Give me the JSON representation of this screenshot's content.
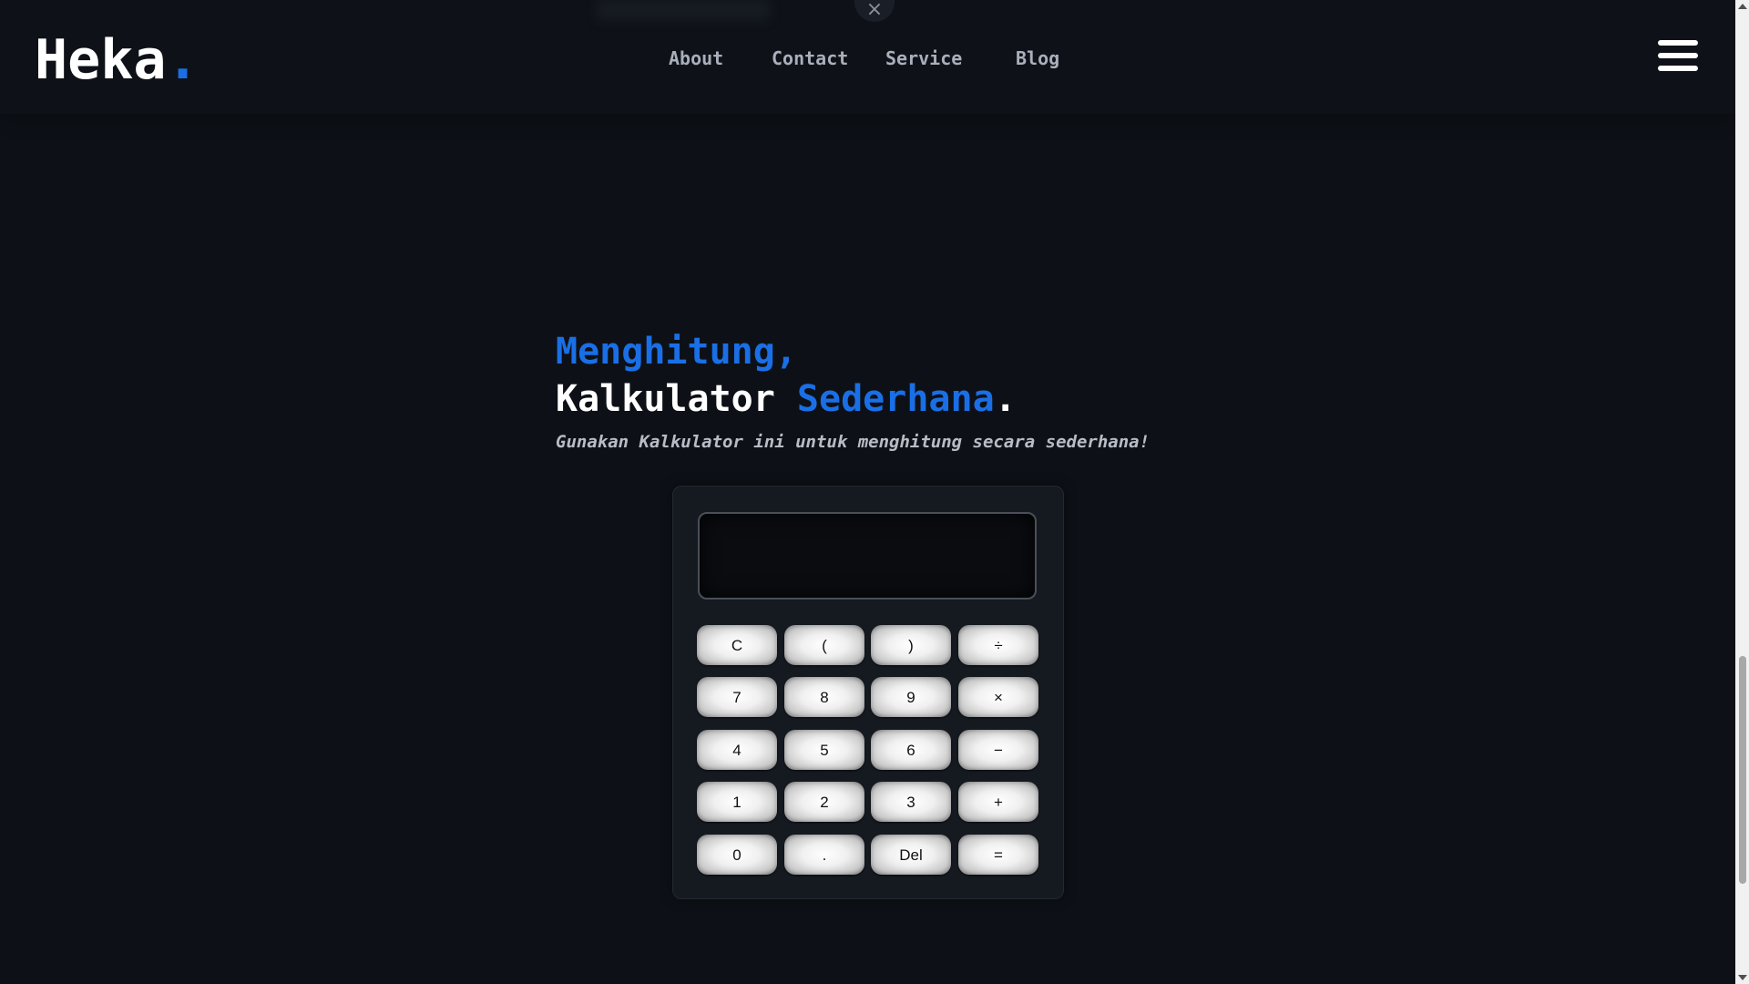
{
  "header": {
    "logo_text": "Heka",
    "logo_dot": ".",
    "nav": [
      {
        "label": "About"
      },
      {
        "label": "Contact"
      },
      {
        "label": "Service"
      },
      {
        "label": "Blog"
      }
    ],
    "close_symbol": "×",
    "menu_icon": "hamburger-menu-icon"
  },
  "hero": {
    "line1": "Menghitung,",
    "line2_white": "Kalkulator ",
    "line2_accent": "Sederhana",
    "line2_end": ".",
    "subtitle": "Gunakan Kalkulator ini untuk menghitung secara sederhana!"
  },
  "calculator": {
    "display_value": "",
    "keys": [
      [
        "C",
        "(",
        ")",
        "÷"
      ],
      [
        "7",
        "8",
        "9",
        "×"
      ],
      [
        "4",
        "5",
        "6",
        "−"
      ],
      [
        "1",
        "2",
        "3",
        "+"
      ],
      [
        "0",
        ".",
        "Del",
        "="
      ]
    ]
  },
  "colors": {
    "background": "#0d1117",
    "accent": "#1a6fe6",
    "text": "#ffffff",
    "nav_text": "#a9afbb"
  }
}
